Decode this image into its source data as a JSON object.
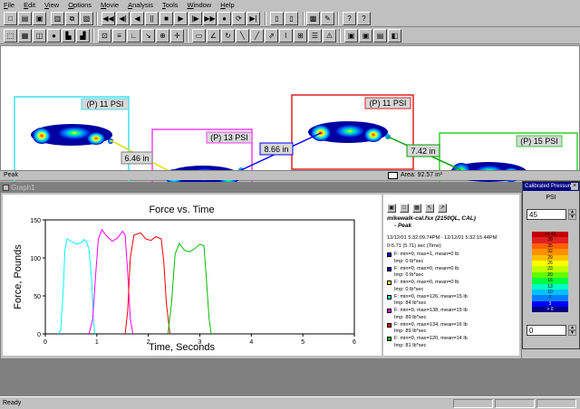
{
  "menu": [
    "File",
    "Edit",
    "View",
    "Options",
    "Movie",
    "Analysis",
    "Tools",
    "Window",
    "Help"
  ],
  "foot_panel": {
    "footprints": [
      {
        "label": "(P) 11 PSI",
        "color": "#40e0f0"
      },
      {
        "label": "(P) 13 PSI",
        "color": "#f040f0"
      },
      {
        "label": "(P) 11 PSI",
        "color": "#e02020"
      },
      {
        "label": "(P) 15 PSI",
        "color": "#30d030"
      }
    ],
    "distances": [
      "6.46 in",
      "8.66 in",
      "7.42 in"
    ],
    "status_left": "Peak",
    "status_area": "Area: 92.57 in²"
  },
  "graph_window": {
    "title": "Graph1",
    "legend": {
      "file": "mikewalk-cal.fsx (2150QL, CAL)",
      "mode": "- Peak",
      "range": "12/12/01 5:32:09.74PM - 12/12/01 5:32:15.44PM",
      "time_range": "0-5.71 (5.71) sec (Time)",
      "items": [
        {
          "color": "#0000ff",
          "f": "F: min=0, max=1, mean=0 lb",
          "imp": "Imp: 0 lb*sec"
        },
        {
          "color": "#0000ff",
          "f": "F: min=0, max=0, mean=0 lb",
          "imp": "Imp: 0 lb*sec"
        },
        {
          "color": "#ffff00",
          "f": "F: min=0, max=0, mean=0 lb",
          "imp": "Imp: 0 lb*sec"
        },
        {
          "color": "#00ffff",
          "f": "F: min=0, max=126, mean=15 lb",
          "imp": "Imp: 84 lb*sec"
        },
        {
          "color": "#ff00ff",
          "f": "F: min=0, max=138, mean=15 lb",
          "imp": "Imp: 89 lb*sec"
        },
        {
          "color": "#ff0000",
          "f": "F: min=0, max=134, mean=16 lb",
          "imp": "Imp: 89 lb*sec"
        },
        {
          "color": "#00c000",
          "f": "F: min=0, max=120, mean=14 lb",
          "imp": "Imp: 81 lb*sec"
        }
      ]
    }
  },
  "calibration": {
    "title": "Calibrated Pressure",
    "unit": "PSI",
    "max_value": "45",
    "min_value": "0",
    "scale": [
      {
        "label": ">= 42",
        "color": "#c00000"
      },
      {
        "label": "39",
        "color": "#e02020"
      },
      {
        "label": "35",
        "color": "#ff6000"
      },
      {
        "label": "32",
        "color": "#ff9000"
      },
      {
        "label": "29",
        "color": "#ffc000"
      },
      {
        "label": "26",
        "color": "#ffff00"
      },
      {
        "label": "23",
        "color": "#c0ff00"
      },
      {
        "label": "20",
        "color": "#60ff00"
      },
      {
        "label": "16",
        "color": "#00ff40"
      },
      {
        "label": "13",
        "color": "#00ffc0"
      },
      {
        "label": "10",
        "color": "#00c0ff"
      },
      {
        "label": "7",
        "color": "#0080ff"
      },
      {
        "label": "3",
        "color": "#0000ff"
      },
      {
        "label": "> 0",
        "color": "#000080"
      }
    ]
  },
  "status": {
    "text": "Ready"
  },
  "chart_data": {
    "type": "line",
    "title": "Force vs. Time",
    "xlabel": "Time, Seconds",
    "ylabel": "Force, Pounds",
    "xlim": [
      0,
      6
    ],
    "ylim": [
      0,
      150
    ],
    "xticks": [
      "0",
      "1",
      "2",
      "3",
      "4",
      "5",
      "6"
    ],
    "yticks": [
      "0",
      "50",
      "100",
      "150"
    ],
    "series": [
      {
        "color": "#00ffff",
        "points": [
          [
            0.25,
            0
          ],
          [
            0.3,
            5
          ],
          [
            0.35,
            60
          ],
          [
            0.38,
            110
          ],
          [
            0.42,
            125
          ],
          [
            0.5,
            122
          ],
          [
            0.6,
            118
          ],
          [
            0.7,
            120
          ],
          [
            0.75,
            124
          ],
          [
            0.8,
            122
          ],
          [
            0.85,
            110
          ],
          [
            0.9,
            70
          ],
          [
            0.93,
            20
          ],
          [
            0.96,
            0
          ]
        ]
      },
      {
        "color": "#ff00ff",
        "points": [
          [
            0.85,
            0
          ],
          [
            0.92,
            20
          ],
          [
            0.98,
            80
          ],
          [
            1.03,
            125
          ],
          [
            1.1,
            137
          ],
          [
            1.2,
            128
          ],
          [
            1.3,
            122
          ],
          [
            1.4,
            126
          ],
          [
            1.5,
            135
          ],
          [
            1.55,
            130
          ],
          [
            1.6,
            80
          ],
          [
            1.65,
            20
          ],
          [
            1.7,
            0
          ]
        ]
      },
      {
        "color": "#ff0000",
        "points": [
          [
            1.55,
            0
          ],
          [
            1.6,
            30
          ],
          [
            1.65,
            100
          ],
          [
            1.72,
            130
          ],
          [
            1.85,
            133
          ],
          [
            1.95,
            125
          ],
          [
            2.05,
            123
          ],
          [
            2.15,
            128
          ],
          [
            2.25,
            125
          ],
          [
            2.3,
            95
          ],
          [
            2.35,
            40
          ],
          [
            2.42,
            0
          ]
        ]
      },
      {
        "color": "#00c000",
        "points": [
          [
            2.38,
            0
          ],
          [
            2.45,
            40
          ],
          [
            2.52,
            105
          ],
          [
            2.6,
            119
          ],
          [
            2.7,
            110
          ],
          [
            2.8,
            108
          ],
          [
            2.9,
            112
          ],
          [
            3.0,
            118
          ],
          [
            3.08,
            116
          ],
          [
            3.12,
            80
          ],
          [
            3.18,
            20
          ],
          [
            3.22,
            0
          ]
        ]
      }
    ]
  }
}
